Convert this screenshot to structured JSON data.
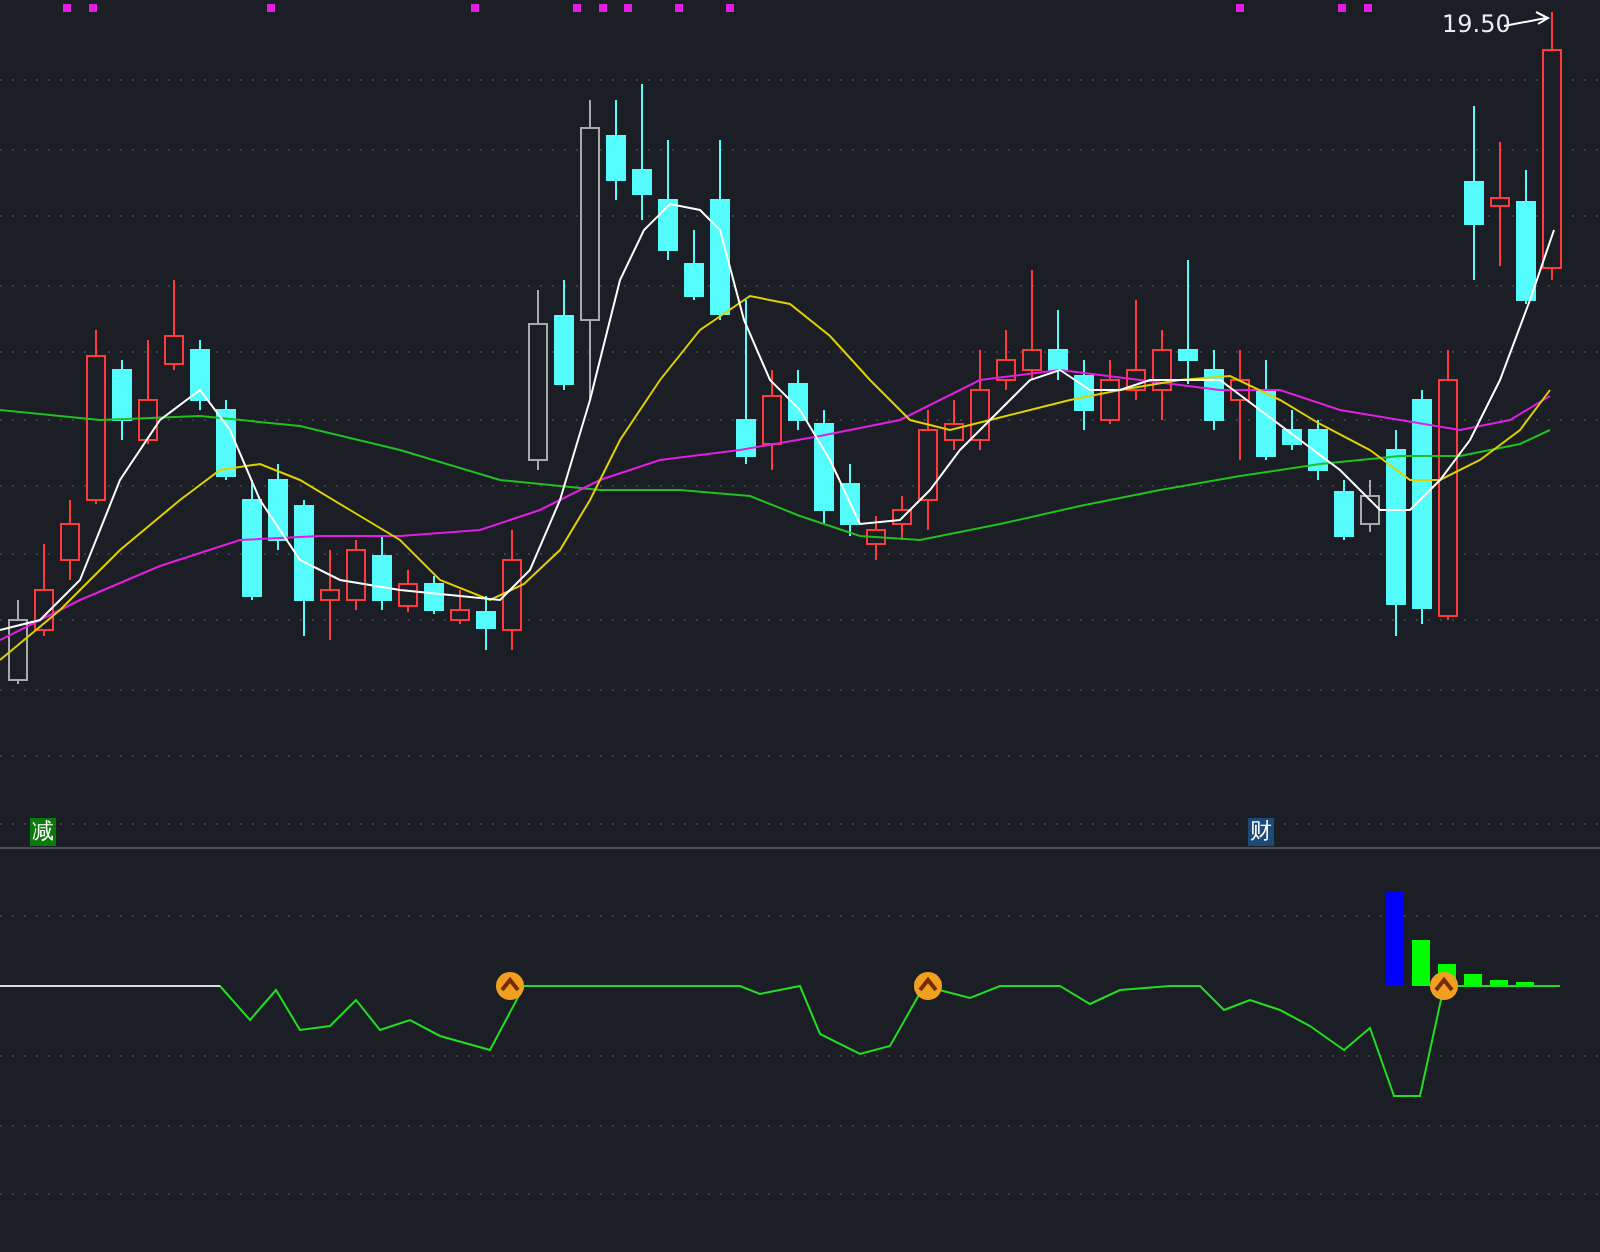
{
  "main_chart": {
    "price_label": "19.50",
    "signal_labels": [
      {
        "text": "减",
        "color": "#0a7a0a"
      },
      {
        "text": "财",
        "color": "#1e4a78"
      }
    ]
  }
}
